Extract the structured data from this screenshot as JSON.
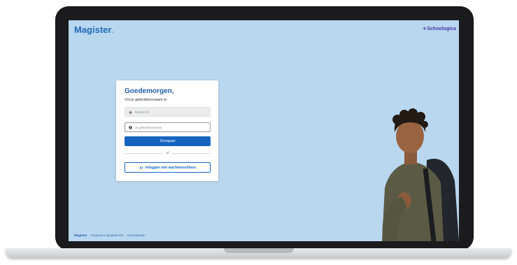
{
  "app": {
    "logo_text": "Magister",
    "logo_dot": ".",
    "partner_mark": "⟡",
    "partner_name": "Schoologica"
  },
  "login": {
    "greeting": "Goedemorgen,",
    "subtitle": "Vul je gebruikersnaam in",
    "school_field": "Demo VO",
    "username_placeholder": "Je gebruikersnaam",
    "submit_label": "Doorgaan",
    "divider_text": "of",
    "passwordless_label": "Inloggen met wachtwoordloos"
  },
  "footer": {
    "brand": "Magister",
    "links": [
      "Gegevens aangeleverd",
      "Voorwaarden"
    ]
  },
  "colors": {
    "screen_bg": "#b9d7ef",
    "primary": "#1565c0",
    "logo": "#1f6bb7"
  }
}
